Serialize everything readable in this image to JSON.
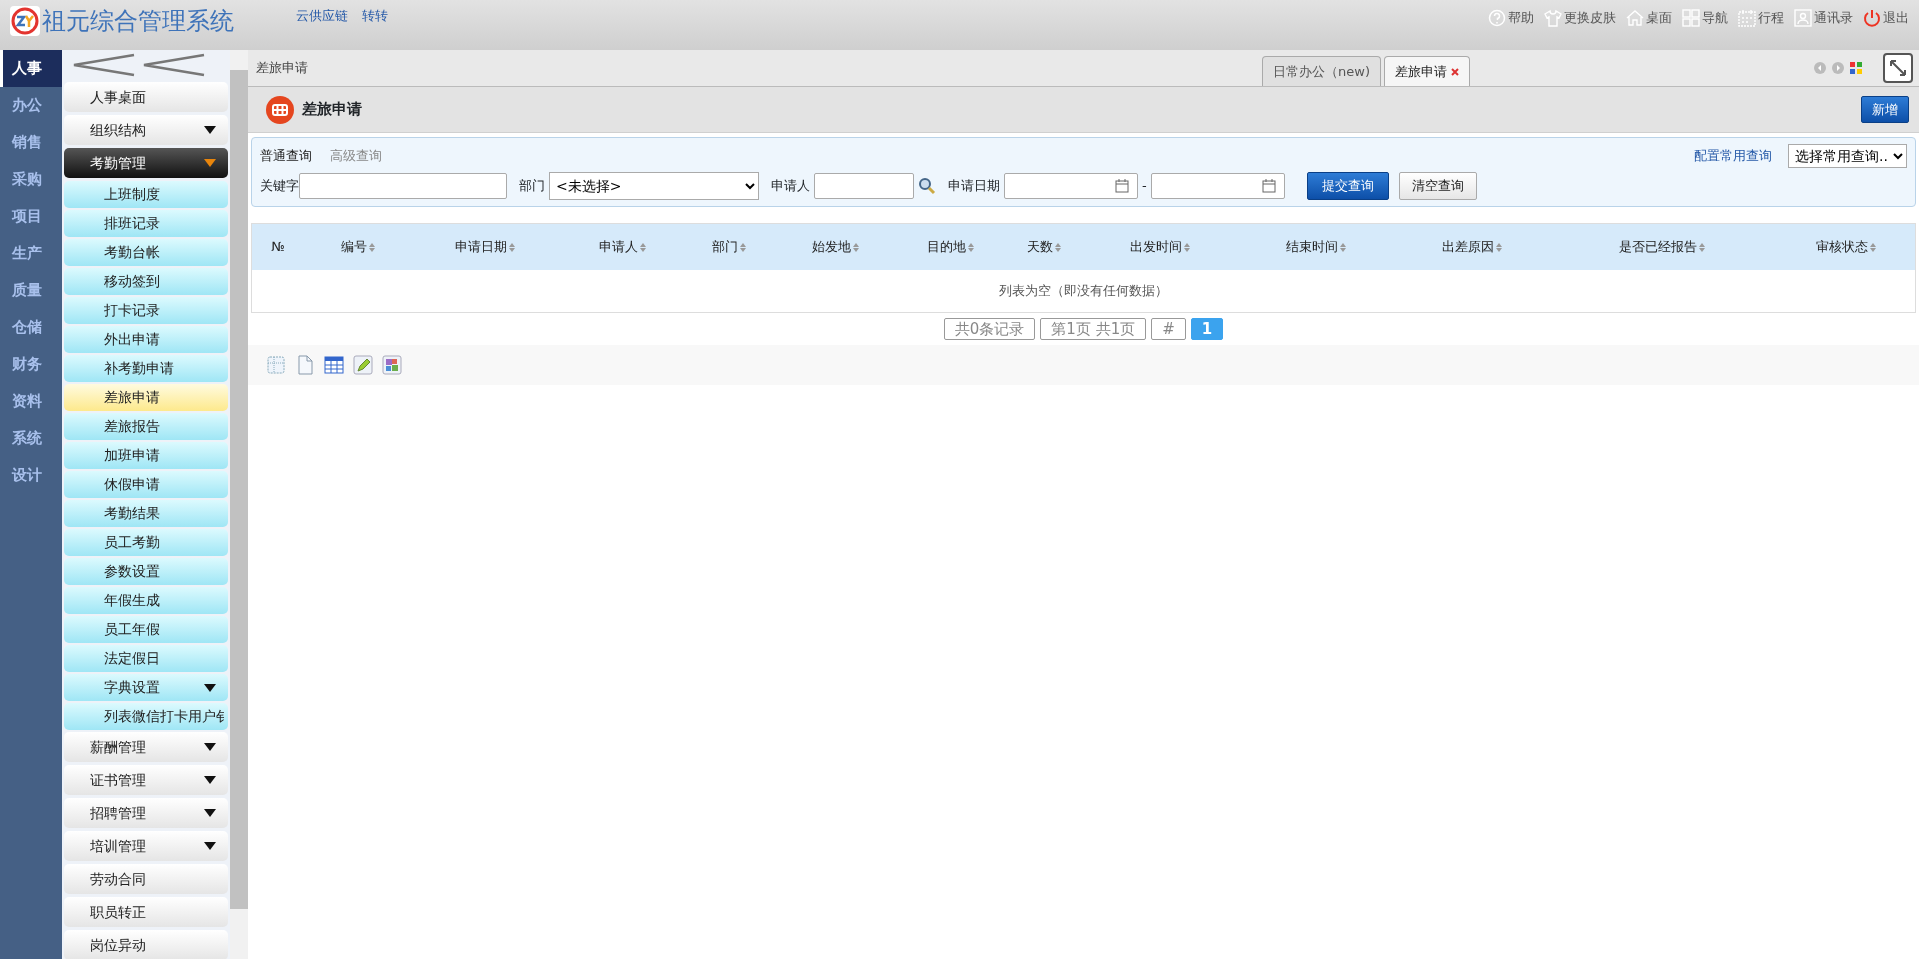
{
  "header": {
    "title": "祖元综合管理系统",
    "links": [
      "云供应链",
      "转转"
    ],
    "menu": [
      {
        "label": "帮助",
        "kind": "help"
      },
      {
        "label": "更换皮肤",
        "kind": "shirt"
      },
      {
        "label": "桌面",
        "kind": "house"
      },
      {
        "label": "导航",
        "kind": "grid"
      },
      {
        "label": "行程",
        "kind": "calendar"
      },
      {
        "label": "通讯录",
        "kind": "contact"
      },
      {
        "label": "退出",
        "kind": "power"
      }
    ]
  },
  "modules": [
    {
      "label": "人事",
      "selected": true
    },
    {
      "label": "办公",
      "selected": false
    },
    {
      "label": "销售",
      "selected": false
    },
    {
      "label": "采购",
      "selected": false
    },
    {
      "label": "项目",
      "selected": false
    },
    {
      "label": "生产",
      "selected": false
    },
    {
      "label": "质量",
      "selected": false
    },
    {
      "label": "仓储",
      "selected": false
    },
    {
      "label": "财务",
      "selected": false
    },
    {
      "label": "资料",
      "selected": false
    },
    {
      "label": "系统",
      "selected": false
    },
    {
      "label": "设计",
      "selected": false
    }
  ],
  "sidebar": {
    "items": [
      {
        "label": "人事桌面",
        "expandable": false,
        "expanded": false
      },
      {
        "label": "组织结构",
        "expandable": true,
        "expanded": false
      },
      {
        "label": "考勤管理",
        "expandable": true,
        "expanded": true,
        "children": [
          {
            "label": "上班制度",
            "selected": false,
            "expandable": false
          },
          {
            "label": "排班记录",
            "selected": false,
            "expandable": false
          },
          {
            "label": "考勤台帐",
            "selected": false,
            "expandable": false
          },
          {
            "label": "移动签到",
            "selected": false,
            "expandable": false
          },
          {
            "label": "打卡记录",
            "selected": false,
            "expandable": false
          },
          {
            "label": "外出申请",
            "selected": false,
            "expandable": false
          },
          {
            "label": "补考勤申请",
            "selected": false,
            "expandable": false
          },
          {
            "label": "差旅申请",
            "selected": true,
            "expandable": false
          },
          {
            "label": "差旅报告",
            "selected": false,
            "expandable": false
          },
          {
            "label": "加班申请",
            "selected": false,
            "expandable": false
          },
          {
            "label": "休假申请",
            "selected": false,
            "expandable": false
          },
          {
            "label": "考勤结果",
            "selected": false,
            "expandable": false
          },
          {
            "label": "员工考勤",
            "selected": false,
            "expandable": false
          },
          {
            "label": "参数设置",
            "selected": false,
            "expandable": false
          },
          {
            "label": "年假生成",
            "selected": false,
            "expandable": false
          },
          {
            "label": "员工年假",
            "selected": false,
            "expandable": false
          },
          {
            "label": "法定假日",
            "selected": false,
            "expandable": false
          },
          {
            "label": "字典设置",
            "selected": false,
            "expandable": true
          },
          {
            "label": "列表微信打卡用户钅",
            "selected": false,
            "expandable": false
          }
        ]
      },
      {
        "label": "薪酬管理",
        "expandable": true,
        "expanded": false
      },
      {
        "label": "证书管理",
        "expandable": true,
        "expanded": false
      },
      {
        "label": "招聘管理",
        "expandable": true,
        "expanded": false
      },
      {
        "label": "培训管理",
        "expandable": true,
        "expanded": false
      },
      {
        "label": "劳动合同",
        "expandable": false,
        "expanded": false
      },
      {
        "label": "职员转正",
        "expandable": false,
        "expanded": false
      },
      {
        "label": "岗位异动",
        "expandable": false,
        "expanded": false
      }
    ]
  },
  "breadcrumb": "差旅申请",
  "tabs": [
    {
      "label": "日常办公（new)",
      "selected": false,
      "closable": false
    },
    {
      "label": "差旅申请",
      "selected": true,
      "closable": true
    }
  ],
  "page_title": "差旅申请",
  "new_button": "新增",
  "query": {
    "modes": [
      {
        "label": "普通查询",
        "selected": true
      },
      {
        "label": "高级查询",
        "selected": false
      }
    ],
    "config_link": "配置常用查询",
    "saved_select": "选择常用查询..",
    "keyword_label": "关键字",
    "dept_label": "部门",
    "dept_value": "<未选择>",
    "applicant_label": "申请人",
    "date_label": "申请日期",
    "date_sep": "-",
    "submit": "提交查询",
    "clear": "清空查询"
  },
  "table": {
    "columns": [
      "№",
      "编号",
      "申请日期",
      "申请人",
      "部门",
      "始发地",
      "目的地",
      "天数",
      "出发时间",
      "结束时间",
      "出差原因",
      "是否已经报告",
      "审核状态"
    ],
    "sortable": [
      false,
      true,
      true,
      true,
      true,
      true,
      true,
      true,
      true,
      true,
      true,
      true,
      true
    ],
    "empty": "列表为空（即没有任何数据）"
  },
  "pagination": {
    "total": "共0条记录",
    "pages": "第1页 共1页",
    "jump": "#",
    "current": "1"
  },
  "tools": [
    {
      "kind": "dotted"
    },
    {
      "kind": "page"
    },
    {
      "kind": "table"
    },
    {
      "kind": "pen"
    },
    {
      "kind": "puzzle"
    }
  ]
}
